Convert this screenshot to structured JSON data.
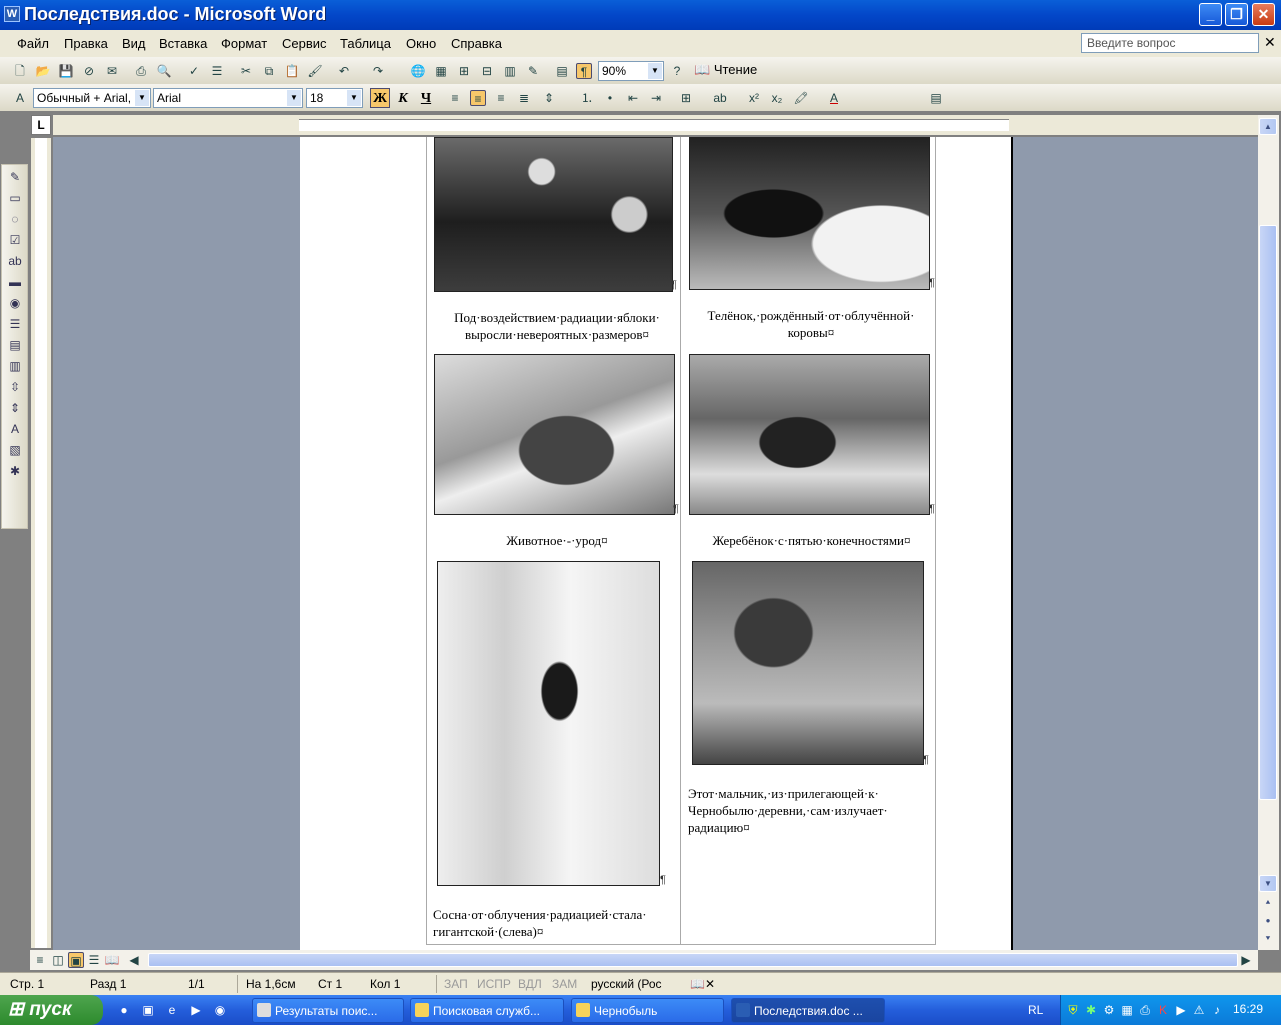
{
  "window": {
    "title": "Последствия.doc - Microsoft Word",
    "icon_letter": "W"
  },
  "menu": {
    "items": [
      "Файл",
      "Правка",
      "Вид",
      "Вставка",
      "Формат",
      "Сервис",
      "Таблица",
      "Окно",
      "Справка"
    ],
    "ask_placeholder": "Введите вопрос"
  },
  "standard_toolbar": {
    "zoom": "90%",
    "reading_label": "Чтение"
  },
  "formatting_toolbar": {
    "style": "Обычный + Arial,",
    "font": "Arial",
    "size": "18",
    "bold": "Ж",
    "italic": "К",
    "underline": "Ч"
  },
  "ruler": {
    "tab_selector": "L"
  },
  "document": {
    "captions": {
      "apples": "Под·воздействием·радиации·яблоки· выросли·невероятных·размеров¤",
      "calf": "Телёнок,·рождённый·от·облучённой· коровы¤",
      "animal": "Животное·-·урод¤",
      "foal": "Жеребёнок·с·пятью·конечностями¤",
      "pine": "Сосна·от·облучения·радиацией·стала· гигантской·(слева)¤",
      "boy": "Этот·мальчик,·из·прилегающей·к· Чернобылю·деревни,·сам·излучает· радиацию¤"
    },
    "paragraph_mark": "¶"
  },
  "statusbar": {
    "page": "Стр. 1",
    "section": "Разд 1",
    "pages": "1/1",
    "at": "На 1,6см",
    "line": "Ст 1",
    "column": "Кол 1",
    "rec": "ЗАП",
    "trk": "ИСПР",
    "ext": "ВДЛ",
    "ovr": "ЗАМ",
    "language": "русский (Рос"
  },
  "taskbar": {
    "start_label": "пуск",
    "tasks": [
      "Результаты поис...",
      "Поисковая служб...",
      "Чернобыль",
      "Последствия.doc ..."
    ],
    "lang_indicator": "RL",
    "clock": "16:29"
  }
}
